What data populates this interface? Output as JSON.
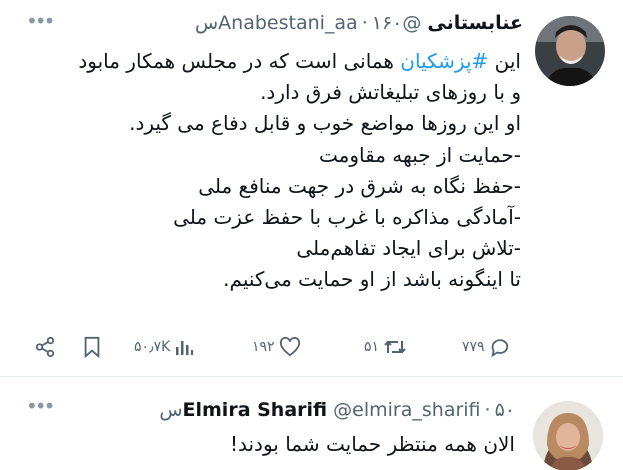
{
  "main_tweet": {
    "display_name": "عنابستانی",
    "handle": "@Anabestani_aa",
    "dot": "·",
    "time": "۱۶۰س",
    "text_lines": [
      {
        "before": "این ",
        "hashtag": "#پزشکیان",
        "after": " همانی است که در مجلس همکار مابود"
      },
      {
        "text": "و با روزهای تبلیغاتش فرق دارد."
      },
      {
        "text": "او این روزها مواضع خوب و قابل دفاع می گیرد."
      },
      {
        "text": "-حمایت از جبهه مقاومت"
      },
      {
        "text": "-حفظ نگاه به شرق در جهت منافع ملی"
      },
      {
        "text": "-آمادگی مذاکره با غرب با حفظ عزت ملی"
      },
      {
        "text": "-تلاش برای ایجاد تفاهم‌ملی"
      },
      {
        "text": "تا اینگونه باشد از او حمایت می‌کنیم."
      }
    ],
    "actions": {
      "views": "۵۰٫۷K",
      "likes": "۱۹۲",
      "retweets": "۵۱",
      "replies": "۷۷۹"
    }
  },
  "reply_tweet": {
    "display_name": "Elmira Sharifi",
    "handle": "@elmira_sharifi",
    "dot": "·",
    "time": "۵۰س",
    "text": "الان همه منتظر حمایت شما بودند!"
  },
  "colors": {
    "accent": "#1d9bf0",
    "secondary_text": "#536471",
    "primary_text": "#0f1419"
  },
  "icons": [
    "more-icon",
    "share-icon",
    "bookmark-icon",
    "views-icon",
    "like-icon",
    "retweet-icon",
    "reply-icon"
  ]
}
